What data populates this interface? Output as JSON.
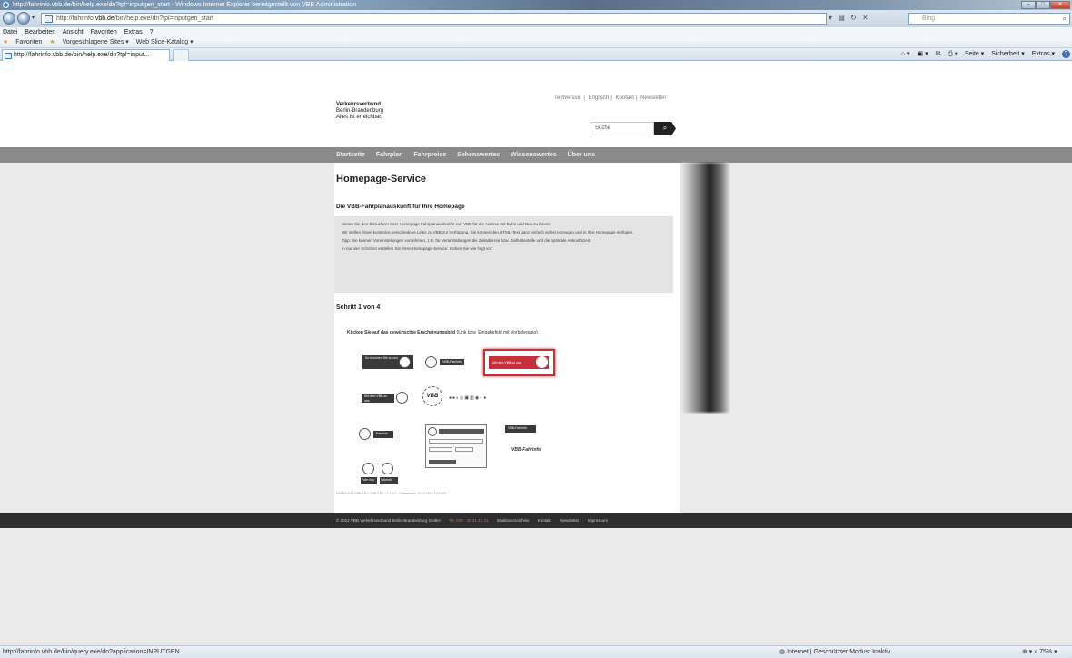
{
  "browser": {
    "title": "http://fahrinfo.vbb.de/bin/help.exe/dn?tpl=inputgen_start - Windows Internet Explorer bereitgestellt von VBB Administration",
    "url_prefix": "http://fahrinfo.",
    "url_domain": "vbb.de",
    "url_rest": "/bin/help.exe/dn?tpl=inputgen_start",
    "search_placeholder": "Bing",
    "menu": [
      "Datei",
      "Bearbeiten",
      "Ansicht",
      "Favoriten",
      "Extras",
      "?"
    ],
    "favorites": {
      "label": "Favoriten",
      "items": [
        "Vorgeschlagene Sites ▾",
        "Web Slice-Katalog ▾"
      ]
    },
    "tab_title": "http://fahrinfo.vbb.de/bin/help.exe/dn?tpl=input...",
    "commands": [
      "Seite ▾",
      "Sicherheit ▾",
      "Extras ▾"
    ],
    "status_url": "http://fahrinfo.vbb.de/bin/query.exe/dn?application=INPUTGEN",
    "status_zone": "Internet | Geschützter Modus: Inaktiv",
    "zoom": "75%"
  },
  "site": {
    "logo_line1": "Verkehrsverbund",
    "logo_line2": "Berlin-Brandenburg",
    "logo_line3": "Alles ist erreichbar.",
    "top_links": [
      "Textversion",
      "Englisch",
      "Kontakt",
      "Newsletter"
    ],
    "search_placeholder": "Suche",
    "nav": [
      "Startseite",
      "Fahrplan",
      "Fahrpreise",
      "Sehenswertes",
      "Wissenswertes",
      "Über uns"
    ],
    "page_title": "Homepage-Service",
    "subtitle": "Die VBB-Fahrplanauskunft für Ihre Homepage",
    "info": [
      "Bieten Sie den Besuchern Ihrer Homepage Fahrplanauskünfte von VBB für die Anreise mit Bahn und Bus zu Ihnen!",
      "Wir stellen Ihnen kostenlos verschiedene Links zu VBB zur Verfügung. Sie können den HTML-Text ganz einfach selbst erzeugen und in Ihre Homepage einfügen.",
      "Tipp: Sie können Voreinstellungen vornehmen, z.B. für Veranstaltungen die Zieladresse bzw. Zielhaltestelle und die optimale Ankunftszeit.",
      "In nur vier Schritten erstellen Sie Ihren Homepage-Service. Gehen Sie wie folgt vor:"
    ],
    "step": "Schritt 1 von 4",
    "instruction_bold": "Klicken Sie auf das gewünschte Erscheinungsbild",
    "instruction_rest": " (Link bzw. Eingabefeld mit Vorbelegung).",
    "widgets": {
      "so_kommen_sie": "So kommen Sie zu uns",
      "vbb_fahrinfo": "VBB-Fahrinfo",
      "mit_dem_vbb": "Mit dem VBB zu uns",
      "vbb": "VBB",
      "fahrinfo": "Fahrinfo",
      "fahrinfo_split": "Fahr info"
    },
    "content_footer": "HAFAS 5.51.VBB.4.8.0 VBB 4.8.1 / 7.9.1.0 - Datenstand: 10.07.2012 14:10:04",
    "footer_copyright": "© 2012 VBB Verkehrsverbund Berlin-Brandenburg GmbH",
    "footer_tel": "Tel. 030 - 25 41 41 41",
    "footer_links": [
      "Inhaltsverzeichnis",
      "Kontakt",
      "Newsletter",
      "Impressum"
    ]
  }
}
